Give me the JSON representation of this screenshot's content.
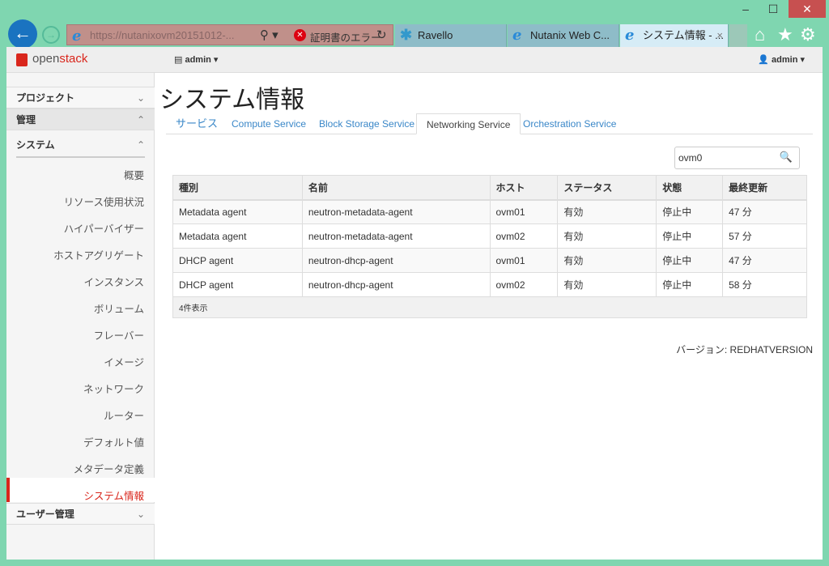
{
  "browser": {
    "url": "https://nutanixovm20151012-...",
    "cert_error": "証明書のエラー",
    "tabs": [
      {
        "label": "Ravello"
      },
      {
        "label": "Nutanix Web C..."
      },
      {
        "label": "システム情報 - ..."
      }
    ]
  },
  "header": {
    "logo": "openstack",
    "project_menu": "admin",
    "user_menu": "admin"
  },
  "sidebar": {
    "sections": [
      {
        "label": "プロジェクト"
      },
      {
        "label": "管理"
      },
      {
        "label": "システム"
      },
      {
        "label": "ユーザー管理"
      }
    ],
    "items": [
      "概要",
      "リソース使用状況",
      "ハイパーバイザー",
      "ホストアグリゲート",
      "インスタンス",
      "ボリューム",
      "フレーバー",
      "イメージ",
      "ネットワーク",
      "ルーター",
      "デフォルト値",
      "メタデータ定義",
      "システム情報"
    ]
  },
  "page": {
    "title": "システム情報",
    "tabs": [
      "サービス",
      "Compute Service",
      "Block Storage Service",
      "Networking Service",
      "Orchestration Service"
    ],
    "active_tab": "Networking Service",
    "search_value": "ovm0",
    "columns": [
      "種別",
      "名前",
      "ホスト",
      "ステータス",
      "状態",
      "最終更新"
    ],
    "rows": [
      [
        "Metadata agent",
        "neutron-metadata-agent",
        "ovm01",
        "有効",
        "停止中",
        "47 分"
      ],
      [
        "Metadata agent",
        "neutron-metadata-agent",
        "ovm02",
        "有効",
        "停止中",
        "57 分"
      ],
      [
        "DHCP agent",
        "neutron-dhcp-agent",
        "ovm01",
        "有効",
        "停止中",
        "47 分"
      ],
      [
        "DHCP agent",
        "neutron-dhcp-agent",
        "ovm02",
        "有効",
        "停止中",
        "58 分"
      ]
    ],
    "footer": "4件表示",
    "version": "バージョン: REDHATVERSION"
  },
  "colors": {
    "accent": "#d9261c",
    "link": "#3a87c8",
    "chrome": "#7fd6b0"
  }
}
